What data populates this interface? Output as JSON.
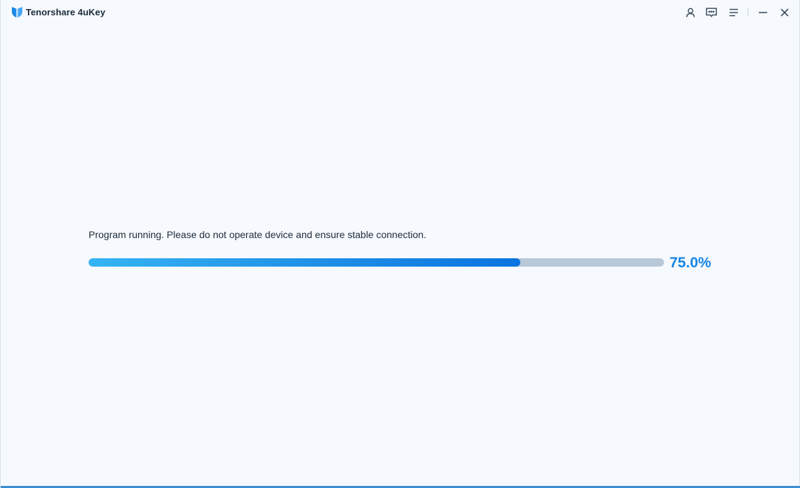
{
  "app": {
    "title": "Tenorshare 4uKey",
    "logo_icon": "tenorshare-logo-icon"
  },
  "titlebar": {
    "icons": [
      "account-icon",
      "feedback-icon",
      "menu-icon",
      "minimize-icon",
      "close-icon"
    ]
  },
  "main": {
    "status_text": "Program running. Please do not operate device and ensure stable connection.",
    "progress": {
      "value_percent": 75.0,
      "label": "75.0%"
    }
  },
  "colors": {
    "accent": "#1585e6",
    "track": "#b9c8d8",
    "background": "#f6f9fd"
  }
}
